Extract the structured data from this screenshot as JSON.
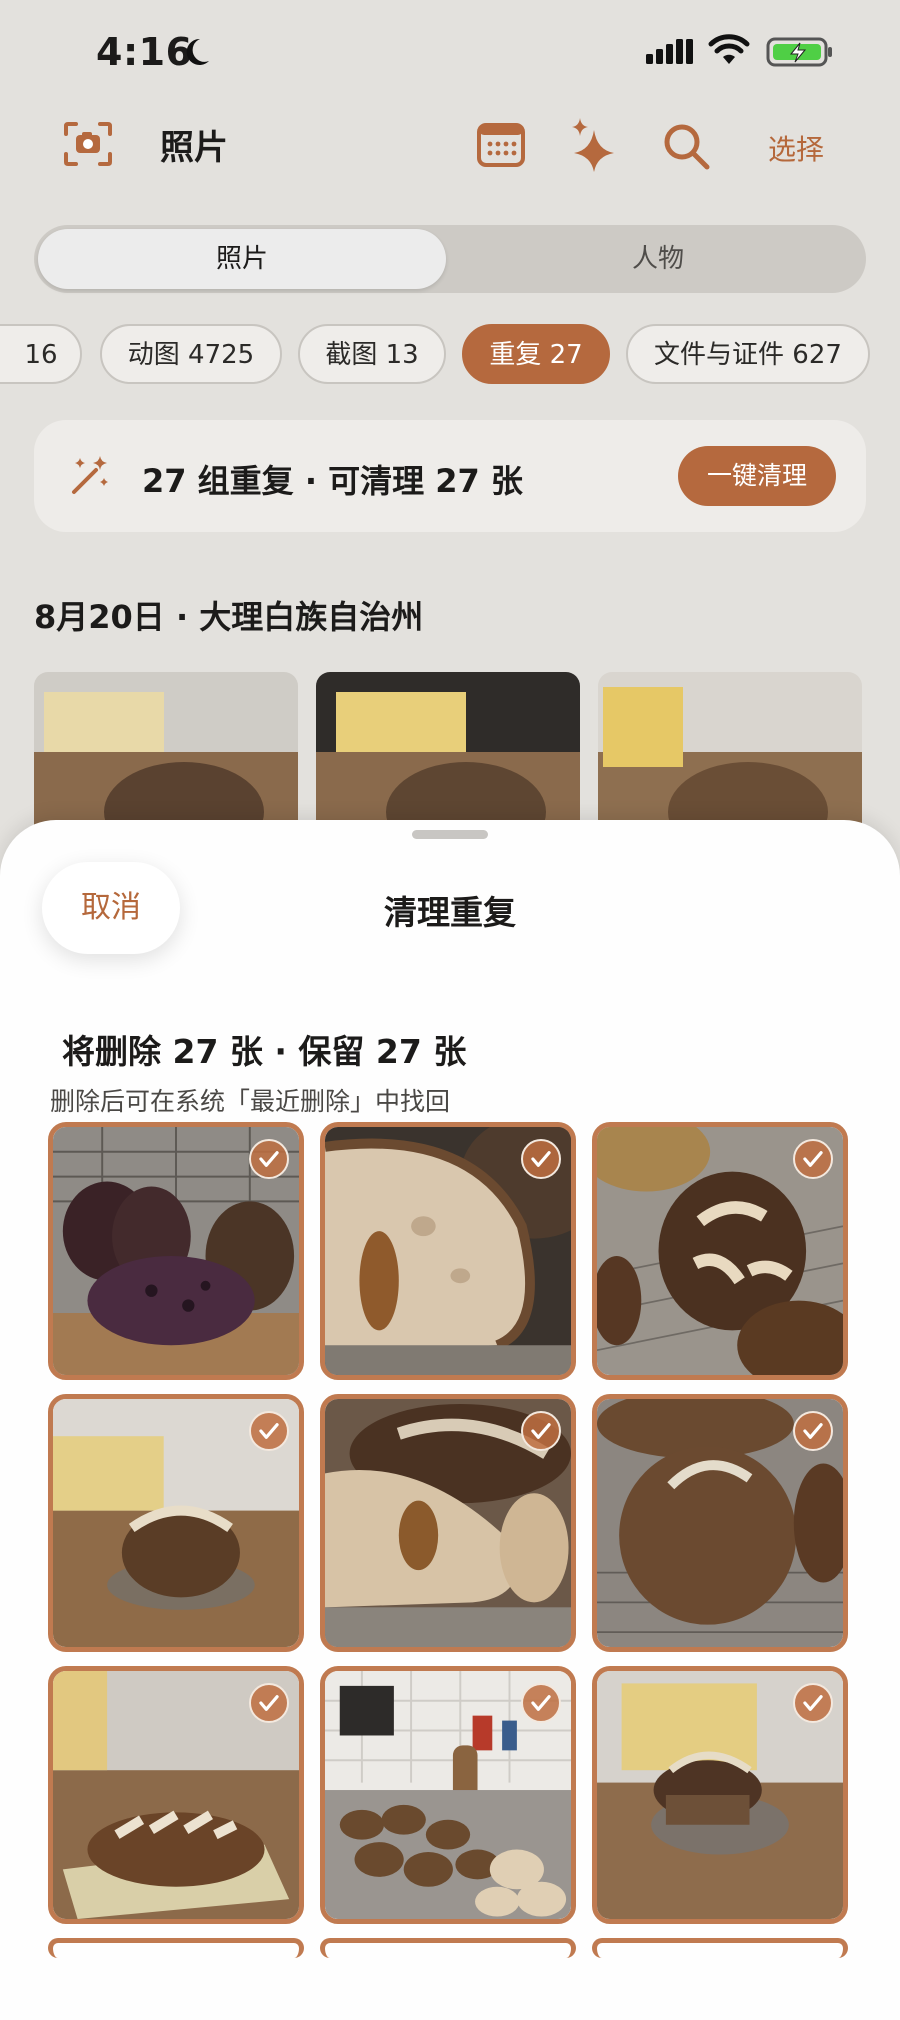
{
  "status": {
    "time": "4:16"
  },
  "header": {
    "title": "照片",
    "select_label": "选择"
  },
  "segments": [
    "照片",
    "人物"
  ],
  "chips": [
    {
      "label": "16",
      "active": false
    },
    {
      "label": "动图 4725",
      "active": false
    },
    {
      "label": "截图 13",
      "active": false
    },
    {
      "label": "重复 27",
      "active": true
    },
    {
      "label": "文件与证件 627",
      "active": false
    }
  ],
  "banner": {
    "text": "27 组重复 · 可清理 27 张",
    "button": "一键清理"
  },
  "section": {
    "date": "8月20日 · 大理白族自治州"
  },
  "sheet": {
    "cancel": "取消",
    "title": "清理重复",
    "summary": "将删除 27 张 · 保留 27 张",
    "note": "删除后可在系统「最近删除」中找回"
  },
  "photos": [
    {
      "subject": "sliced-dark-bread-on-rack",
      "selected": true
    },
    {
      "subject": "bread-crumb-closeup",
      "selected": true
    },
    {
      "subject": "scored-boule-on-rack",
      "selected": true
    },
    {
      "subject": "boule-on-plate",
      "selected": true
    },
    {
      "subject": "bread-crumb-on-plate",
      "selected": true
    },
    {
      "subject": "scored-boule-on-rack",
      "selected": true
    },
    {
      "subject": "batard-on-tray",
      "selected": true
    },
    {
      "subject": "bakery-counter",
      "selected": true
    },
    {
      "subject": "sliced-boule-on-board",
      "selected": true
    }
  ],
  "colors": {
    "accent": "#b5693e",
    "background": "#e3e1dd",
    "sheet": "#fefefe"
  }
}
